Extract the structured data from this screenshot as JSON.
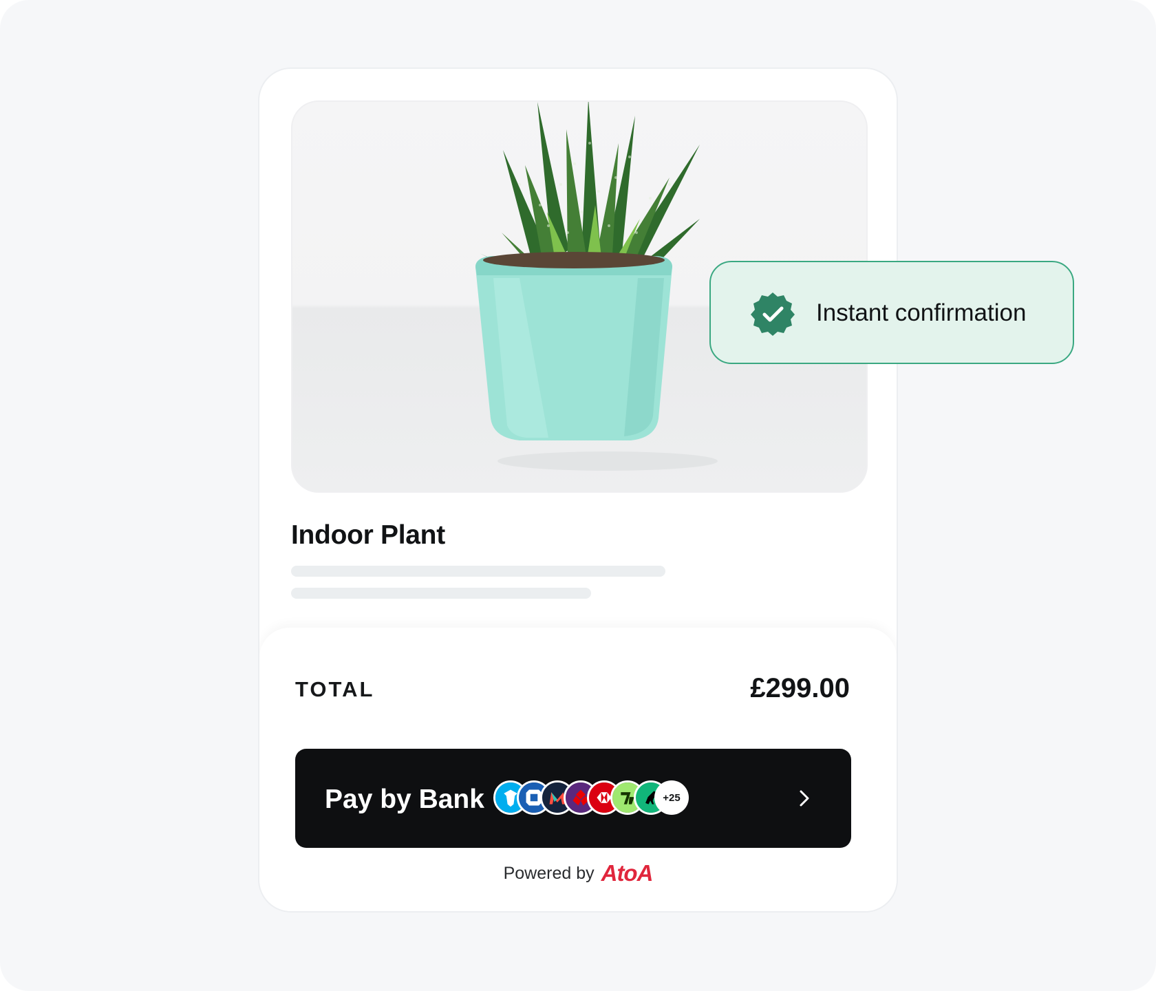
{
  "product": {
    "title": "Indoor Plant",
    "image_alt": "Succulent plant in a mint green pot"
  },
  "checkout": {
    "total_label": "TOTAL",
    "total_value": "£299.00",
    "pay_button_label": "Pay by Bank",
    "more_banks_badge": "+25",
    "powered_by_label": "Powered by",
    "brand_name": "AtoA"
  },
  "notification": {
    "text": "Instant confirmation",
    "icon": "verified-check-icon"
  },
  "banks": [
    {
      "icon": "barclays-eagle-icon",
      "color": "#00aeef"
    },
    {
      "icon": "chase-octagon-icon",
      "color": "#1a5fb4"
    },
    {
      "icon": "monzo-m-icon",
      "color": "#14233c"
    },
    {
      "icon": "natwest-cubes-icon",
      "color": "#5a287d"
    },
    {
      "icon": "hsbc-hexagon-icon",
      "color": "#db0011"
    },
    {
      "icon": "wise-flag-icon",
      "color": "#9fe870"
    },
    {
      "icon": "lloyds-horse-icon",
      "color": "#11b67a"
    }
  ],
  "colors": {
    "accent_green": "#3aa881",
    "badge_background": "#e3f3ec",
    "button_background": "#0e0f11",
    "brand_red": "#e0263c",
    "pot_mint": "#9de3d6"
  }
}
